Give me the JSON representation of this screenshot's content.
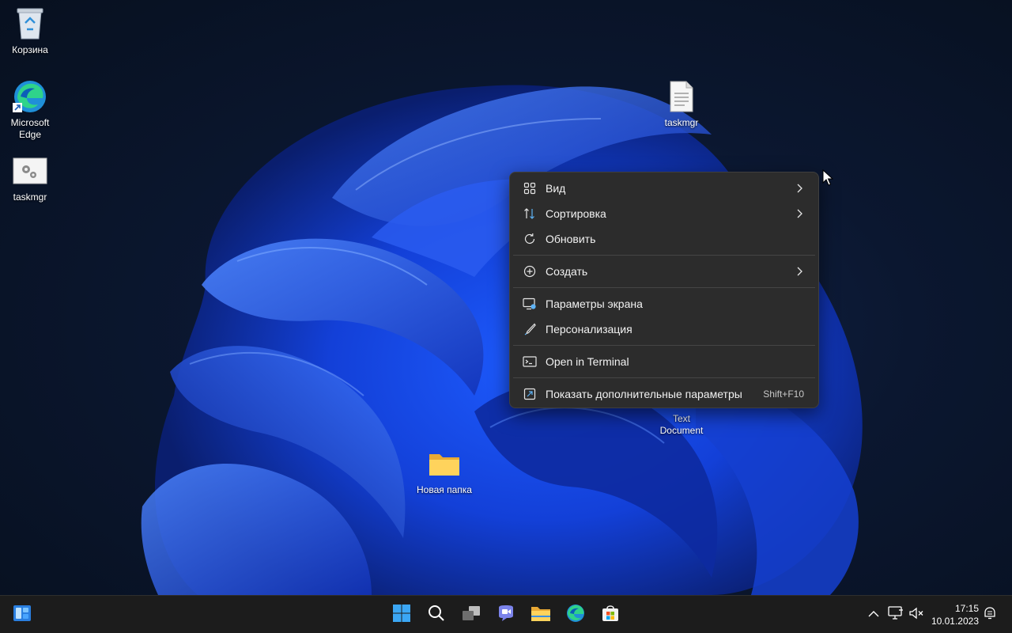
{
  "desktop": {
    "icons": [
      {
        "label": "Корзина",
        "icon": "recycle-bin-icon"
      },
      {
        "label": "Microsoft Edge",
        "icon": "edge-icon"
      },
      {
        "label": "taskmgr",
        "icon": "config-file-icon"
      },
      {
        "label": "taskmgr",
        "icon": "text-file-icon"
      },
      {
        "label": "Text Document",
        "icon": "text-file-icon"
      },
      {
        "label": "Новая папка",
        "icon": "folder-icon"
      }
    ]
  },
  "context_menu": {
    "items": [
      {
        "label": "Вид",
        "icon": "grid-view-icon",
        "has_submenu": true
      },
      {
        "label": "Сортировка",
        "icon": "sort-icon",
        "has_submenu": true
      },
      {
        "label": "Обновить",
        "icon": "refresh-icon"
      },
      {
        "label": "Создать",
        "icon": "new-plus-icon",
        "has_submenu": true
      },
      {
        "label": "Параметры экрана",
        "icon": "display-settings-icon"
      },
      {
        "label": "Персонализация",
        "icon": "brush-icon"
      },
      {
        "label": "Open in Terminal",
        "icon": "terminal-icon"
      },
      {
        "label": "Показать дополнительные параметры",
        "icon": "more-options-icon",
        "shortcut": "Shift+F10"
      }
    ]
  },
  "taskbar": {
    "widgets_icon": "widgets-icon",
    "apps": [
      {
        "name": "start",
        "icon": "windows-start-icon"
      },
      {
        "name": "search",
        "icon": "search-icon"
      },
      {
        "name": "task-view",
        "icon": "task-view-icon"
      },
      {
        "name": "chat",
        "icon": "teams-chat-icon"
      },
      {
        "name": "file-explorer",
        "icon": "folder-icon"
      },
      {
        "name": "edge",
        "icon": "edge-icon"
      },
      {
        "name": "store",
        "icon": "store-icon"
      }
    ],
    "tray": {
      "time": "17:15",
      "date": "10.01.2023",
      "icons": [
        "chevron-up-icon",
        "network-icon",
        "volume-muted-icon",
        "notification-icon"
      ]
    }
  },
  "colors": {
    "accent": "#0078d4",
    "menu_bg": "#2c2c2c",
    "taskbar_bg": "#1c1c1c"
  }
}
